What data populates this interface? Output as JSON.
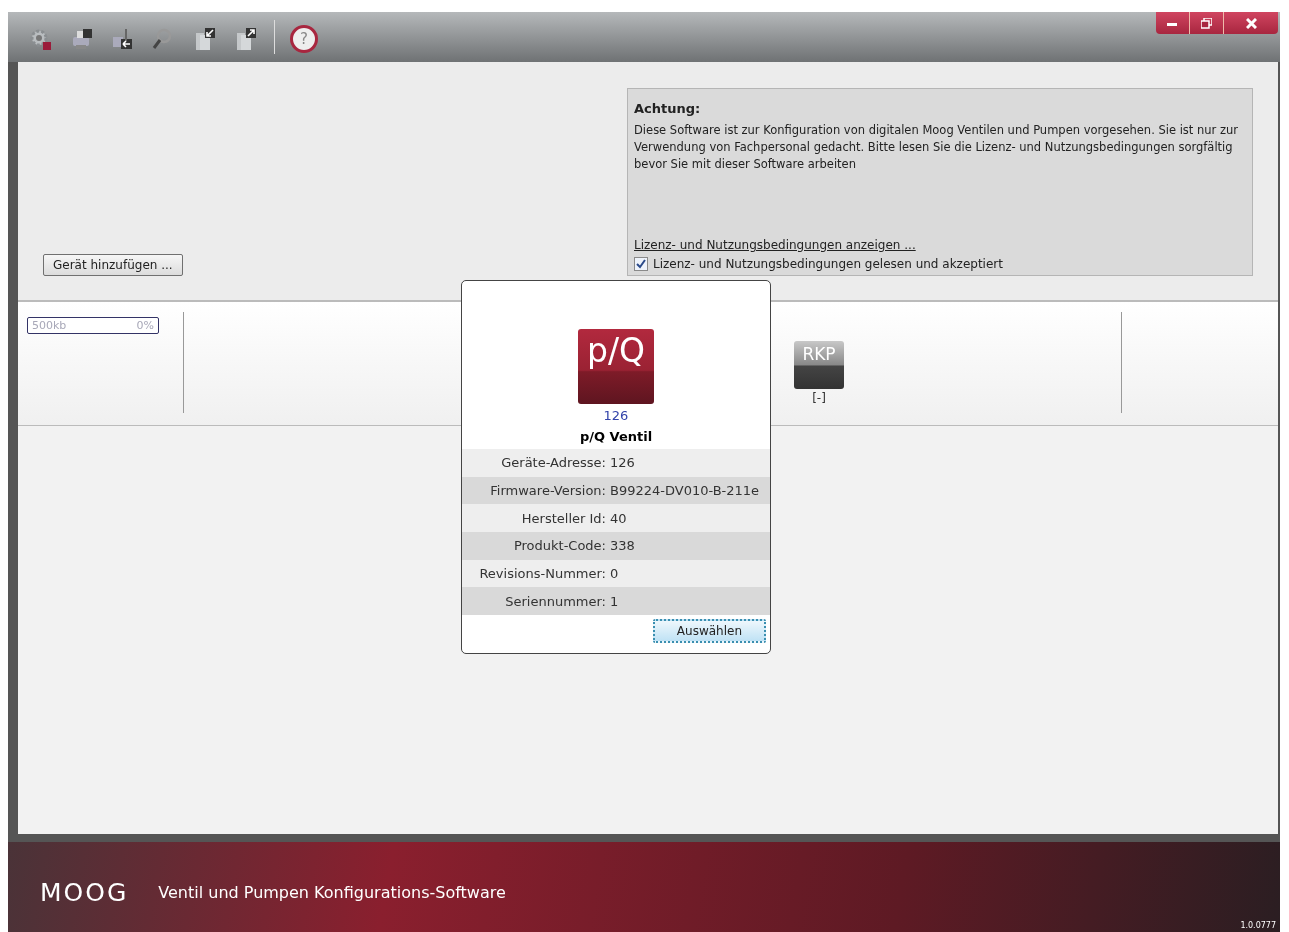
{
  "toolbar": {
    "tools": [
      {
        "kind": "gear"
      },
      {
        "kind": "printer"
      },
      {
        "kind": "import"
      },
      {
        "kind": "search"
      },
      {
        "kind": "doc-in"
      },
      {
        "kind": "doc-out"
      }
    ],
    "help": {
      "label": "?"
    }
  },
  "window_controls": [
    {
      "kind": "minimize"
    },
    {
      "kind": "restore"
    },
    {
      "kind": "close"
    }
  ],
  "add_device_button": "Gerät hinzufügen ...",
  "notice": {
    "title": "Achtung:",
    "text": "Diese Software ist zur Konfiguration von digitalen Moog Ventilen und Pumpen vorgesehen. Sie ist nur zur Verwendung von Fachpersonal gedacht. Bitte lesen Sie die Lizenz- und Nutzungsbedingungen sorgfältig bevor Sie mit dieser Software arbeiten",
    "link": "Lizenz- und Nutzungsbedingungen anzeigen ...",
    "checkbox": {
      "label": "Lizenz- und Nutzungsbedingungen gelesen und akzeptiert",
      "checked": true
    }
  },
  "bus": {
    "baudrate": "500kb",
    "load": "0%",
    "level": 0
  },
  "devices": [
    {
      "icon_label": "RKP",
      "address": "[-]"
    }
  ],
  "dialog": {
    "icon_label": "p/Q",
    "address": "126",
    "name": "p/Q Ventil",
    "properties": [
      {
        "label": "Geräte-Adresse:",
        "value": "126"
      },
      {
        "label": "Firmware-Version:",
        "value": "B99224-DV010-B-211e"
      },
      {
        "label": "Hersteller Id:",
        "value": "40"
      },
      {
        "label": "Produkt-Code:",
        "value": "338"
      },
      {
        "label": "Revisions-Nummer:",
        "value": "0"
      },
      {
        "label": "Seriennummer:",
        "value": "1"
      }
    ],
    "button": "Auswählen"
  },
  "footer": {
    "logo": "MOOG",
    "title": "Ventil und Pumpen Konfigurations-Software",
    "version": "1.0.0777"
  }
}
